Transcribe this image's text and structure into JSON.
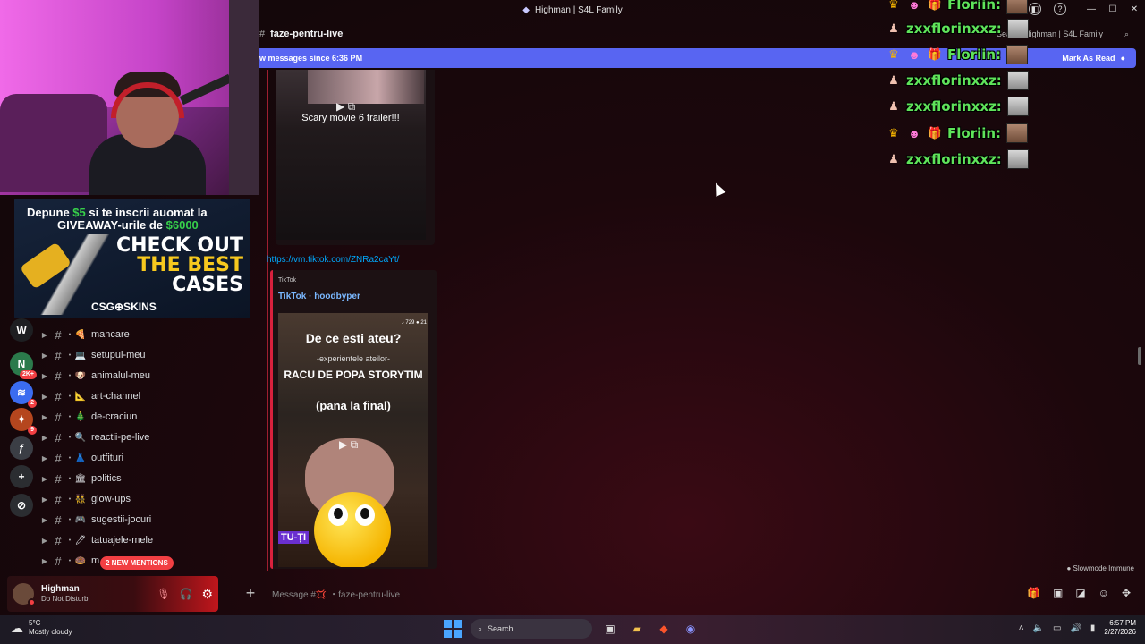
{
  "window": {
    "title": "Highman | S4L Family",
    "controls": [
      "—",
      "☐",
      "✕"
    ]
  },
  "titlebar_icons": [
    "◧",
    "?"
  ],
  "channel_header": {
    "name": "faze-pentru-live",
    "search_placeholder": "Search Highman | S4L Family"
  },
  "new_messages_bar": {
    "text": "w messages since 6:36 PM",
    "mark_label": "Mark As Read"
  },
  "ad": {
    "line1_pre": "Depune ",
    "line1_amount": "$5",
    "line1_post": " si te inscrii auomat la",
    "line2_pre": "GIVEAWAY-urile de ",
    "line2_amount": "$6000",
    "cta_1": "CHECK OUT",
    "cta_2": "THE BEST",
    "cta_3": "CASES",
    "brand": "CSG⊕SKINS"
  },
  "servers": [
    {
      "label": "W",
      "color": "#1e1f22",
      "badge": ""
    },
    {
      "label": "N",
      "color": "#2b7a4b",
      "badge": "2K+"
    },
    {
      "label": "≋",
      "color": "#3b6cf0",
      "badge": "2"
    },
    {
      "label": "✦",
      "color": "#b5461e",
      "badge": "9"
    },
    {
      "label": "ƒ",
      "color": "#3b3e45",
      "badge": ""
    },
    {
      "label": "+",
      "color": "#2b2d31",
      "badge": ""
    },
    {
      "label": "⊘",
      "color": "#2b2d31",
      "badge": ""
    }
  ],
  "channels": [
    {
      "name": "mancare",
      "emoji": "🍕"
    },
    {
      "name": "setupul-meu",
      "emoji": "💻"
    },
    {
      "name": "animalul-meu",
      "emoji": "🐶"
    },
    {
      "name": "art-channel",
      "emoji": "📐"
    },
    {
      "name": "de-craciun",
      "emoji": "🎄"
    },
    {
      "name": "reactii-pe-live",
      "emoji": "🔍"
    },
    {
      "name": "outfituri",
      "emoji": "👗"
    },
    {
      "name": "politics",
      "emoji": "🏛"
    },
    {
      "name": "glow-ups",
      "emoji": "👯"
    },
    {
      "name": "sugestii-jocuri",
      "emoji": "🎮"
    },
    {
      "name": "tatuajele-mele",
      "emoji": "🖊"
    },
    {
      "name": "m",
      "emoji": "🍩"
    }
  ],
  "mentions_pill": "2 NEW MENTIONS",
  "user": {
    "name": "Highman",
    "status": "Do Not Disturb"
  },
  "messages": {
    "embed1_caption": "Scary movie 6 trailer!!!",
    "link": "https://vm.tiktok.com/ZNRa2caYt/",
    "embed2_provider": "TikTok",
    "embed2_author": "TikTok · hoodbyper",
    "video_title": "De ce esti ateu?",
    "video_sub": "-experientele ateilor-",
    "video_line3": "RACU DE POPA  STORYTIM",
    "video_line4": "(pana la final)",
    "video_stats": "♪ 729  ● 21",
    "video_tag": "TU-ȚI"
  },
  "chat_overlay": [
    {
      "name": "Floriin:",
      "badges": [
        "crown",
        "face",
        "gift"
      ],
      "color": "green",
      "emote": "a"
    },
    {
      "name": "zxxflorinxxz:",
      "badges": [
        "hat"
      ],
      "color": "green",
      "emote": "b"
    },
    {
      "name": "Floriin:",
      "badges": [
        "crown",
        "face",
        "gift"
      ],
      "color": "green",
      "emote": "a"
    },
    {
      "name": "zxxflorinxxz:",
      "badges": [
        "hat"
      ],
      "color": "green",
      "emote": "b"
    },
    {
      "name": "zxxflorinxxz:",
      "badges": [
        "hat"
      ],
      "color": "green",
      "emote": "b"
    },
    {
      "name": "Floriin:",
      "badges": [
        "crown",
        "face",
        "gift"
      ],
      "color": "green",
      "emote": "a"
    },
    {
      "name": "zxxflorinxxz:",
      "badges": [
        "hat"
      ],
      "color": "green",
      "emote": "b"
    }
  ],
  "slowmode": "● Slowmode Immune",
  "composer": {
    "placeholder": "Message #💢 ・faze-pentru-live"
  },
  "taskbar": {
    "temp": "5°C",
    "weather": "Mostly cloudy",
    "search": "Search",
    "time": "6:57 PM",
    "date": "2/27/2026"
  }
}
